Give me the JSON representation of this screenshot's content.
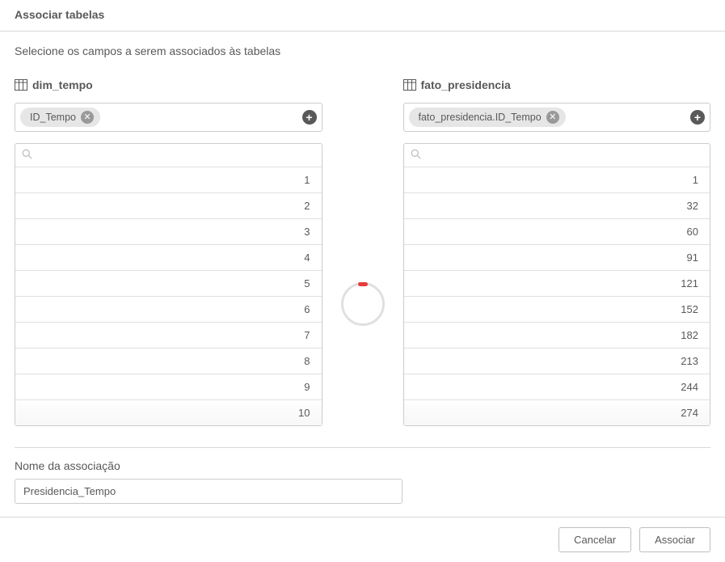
{
  "header": {
    "title": "Associar tabelas"
  },
  "instruction": "Selecione os campos a serem associados às tabelas",
  "left": {
    "table_name": "dim_tempo",
    "chip_label": "ID_Tempo",
    "rows": [
      "1",
      "2",
      "3",
      "4",
      "5",
      "6",
      "7",
      "8",
      "9",
      "10"
    ]
  },
  "right": {
    "table_name": "fato_presidencia",
    "chip_label": "fato_presidencia.ID_Tempo",
    "rows": [
      "1",
      "32",
      "60",
      "91",
      "121",
      "152",
      "182",
      "213",
      "244",
      "274"
    ]
  },
  "assoc": {
    "label": "Nome da associação",
    "value": "Presidencia_Tempo"
  },
  "buttons": {
    "cancel": "Cancelar",
    "confirm": "Associar"
  },
  "search_placeholder": ""
}
